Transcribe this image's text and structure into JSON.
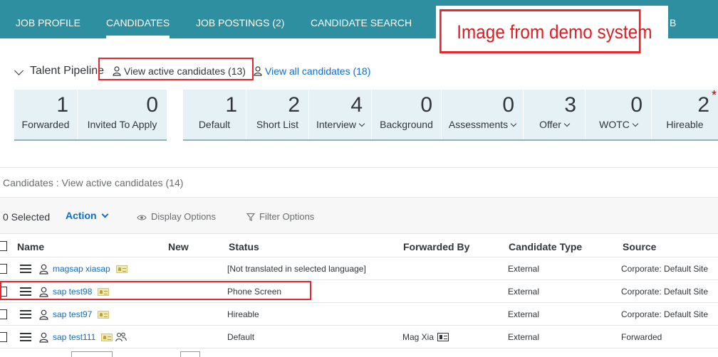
{
  "nav": {
    "tabs": [
      {
        "label": "JOB PROFILE"
      },
      {
        "label": "CANDIDATES"
      },
      {
        "label": "JOB POSTINGS (2)"
      },
      {
        "label": "CANDIDATE SEARCH"
      },
      {
        "label": "B"
      }
    ],
    "active_tab": "CANDIDATES",
    "bar_color": "#2e8fa0"
  },
  "overlay": {
    "text": "Image from demo system",
    "color": "#e11b22"
  },
  "pipeline": {
    "title": "Talent Pipeline",
    "view_active": "View active candidates (13)",
    "view_all": "View all candidates (18)",
    "tiles_left": [
      {
        "count": "1",
        "label": "Forwarded"
      },
      {
        "count": "0",
        "label": "Invited To Apply"
      }
    ],
    "tiles_right": [
      {
        "count": "1",
        "label": "Default"
      },
      {
        "count": "2",
        "label": "Short List"
      },
      {
        "count": "4",
        "label": "Interview"
      },
      {
        "count": "0",
        "label": "Background"
      },
      {
        "count": "0",
        "label": "Assessments"
      },
      {
        "count": "3",
        "label": "Offer"
      },
      {
        "count": "0",
        "label": "WOTC"
      },
      {
        "count": "2",
        "label": "Hireable"
      }
    ]
  },
  "summary": "Candidates : View active candidates (14)",
  "toolbar": {
    "selected": "0 Selected",
    "action": "Action",
    "display_options": "Display Options",
    "filter_options": "Filter Options"
  },
  "table": {
    "headers": {
      "name": "Name",
      "new": "New",
      "status": "Status",
      "forwarded_by": "Forwarded By",
      "candidate_type": "Candidate Type",
      "source": "Source"
    },
    "rows": [
      {
        "name": "magsap xiasap",
        "status": "[Not translated in selected language]",
        "forwarded_by": "",
        "type": "External",
        "source": "Corporate: Default Site"
      },
      {
        "name": "sap test98",
        "status": "Phone Screen",
        "forwarded_by": "",
        "type": "External",
        "source": "Corporate: Default Site"
      },
      {
        "name": "sap test97",
        "status": "Hireable",
        "forwarded_by": "",
        "type": "External",
        "source": "Corporate: Default Site"
      },
      {
        "name": "sap test111",
        "status": "Default",
        "forwarded_by": "Mag Xia",
        "type": "External",
        "source": "Forwarded"
      }
    ]
  },
  "colors": {
    "link": "#0a6ed1",
    "highlight_box": "#e8262c",
    "tile_bg": "#e6f1f5"
  }
}
